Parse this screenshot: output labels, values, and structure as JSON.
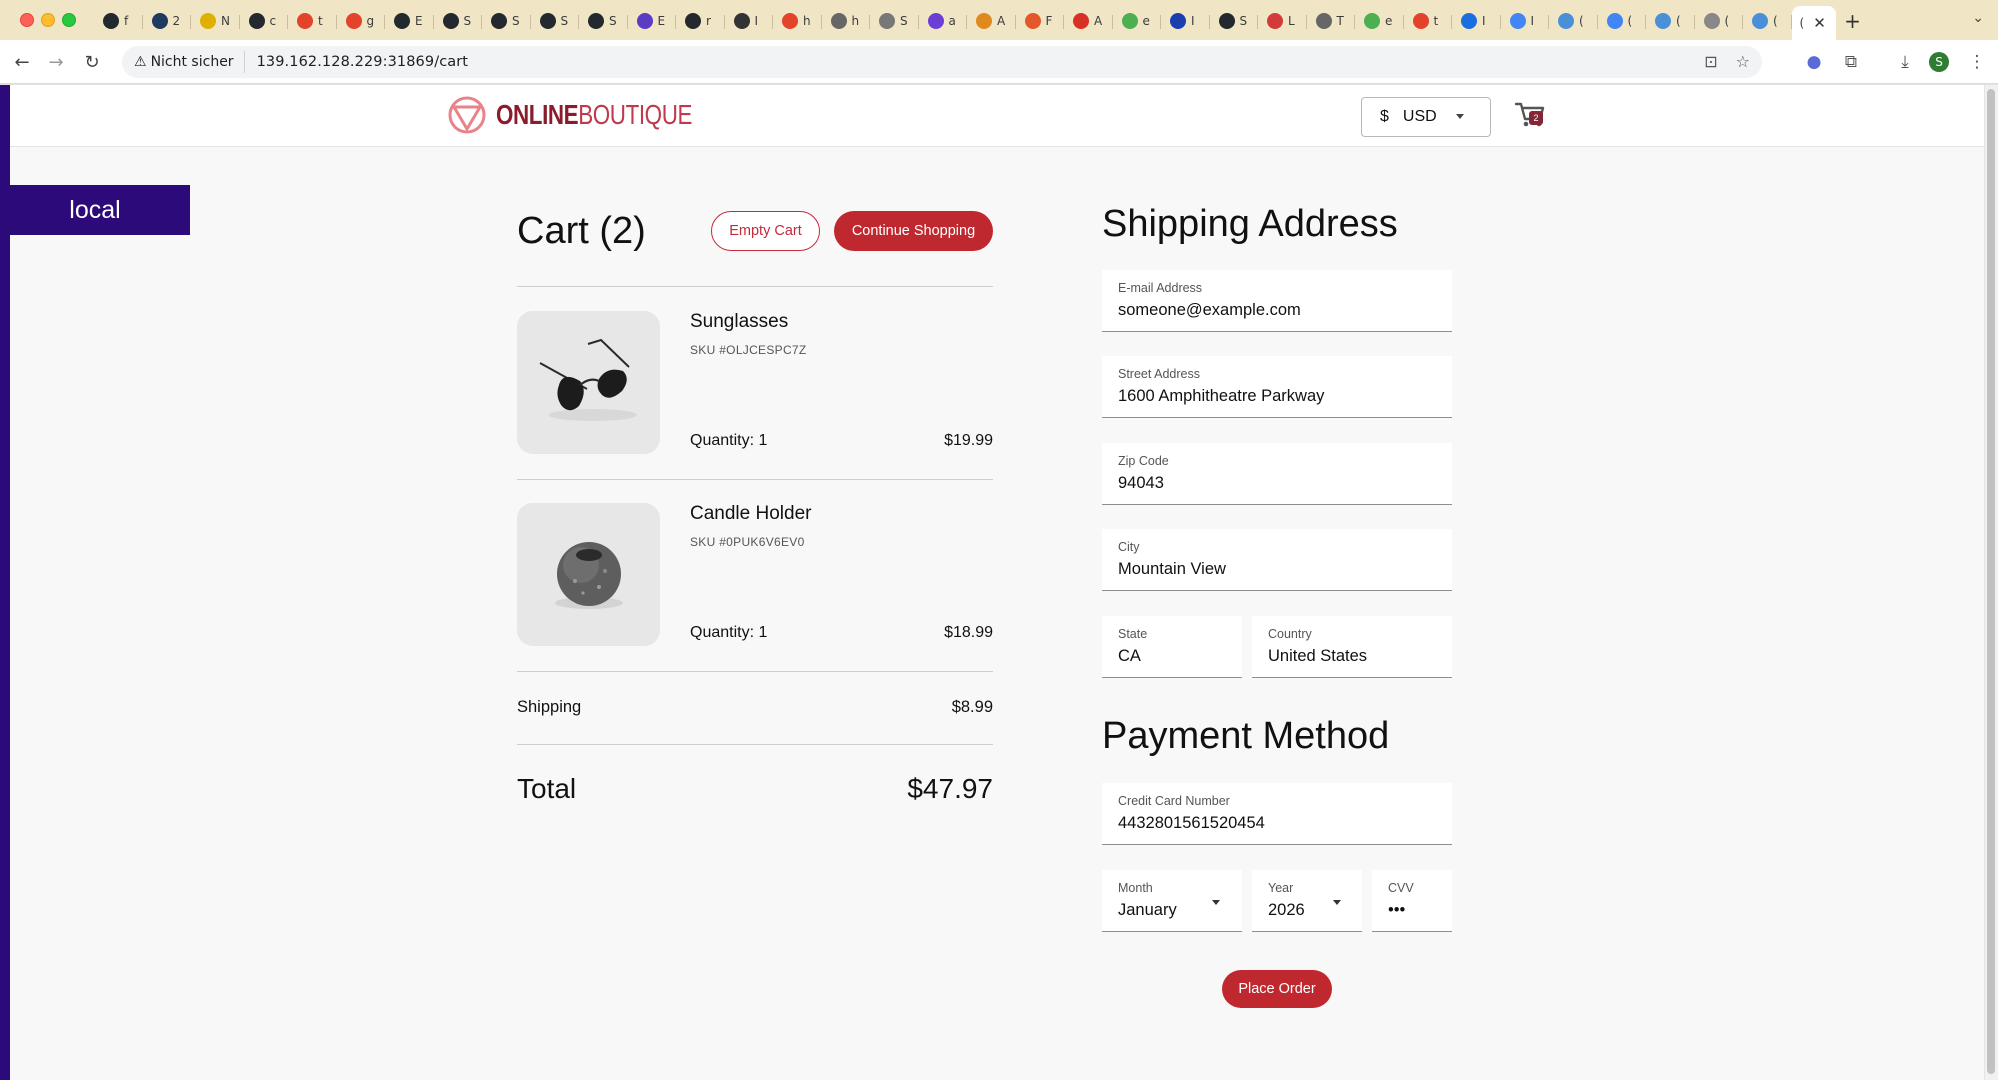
{
  "browser": {
    "tabs": [
      {
        "icon": "github-icon",
        "letter": "f",
        "color": "#24292f"
      },
      {
        "icon": "app-icon",
        "letter": "2",
        "color": "#1f3a5f"
      },
      {
        "icon": "yellow-app-icon",
        "letter": "N",
        "color": "#e0b000"
      },
      {
        "icon": "github-icon",
        "letter": "c",
        "color": "#24292f"
      },
      {
        "icon": "gitlab-icon",
        "letter": "t",
        "color": "#e24329"
      },
      {
        "icon": "gitlab-icon",
        "letter": "g",
        "color": "#e24329"
      },
      {
        "icon": "github-icon",
        "letter": "E",
        "color": "#24292f"
      },
      {
        "icon": "github-icon",
        "letter": "S",
        "color": "#24292f"
      },
      {
        "icon": "github-icon",
        "letter": "S",
        "color": "#24292f"
      },
      {
        "icon": "github-icon",
        "letter": "S",
        "color": "#24292f"
      },
      {
        "icon": "github-icon",
        "letter": "S",
        "color": "#24292f"
      },
      {
        "icon": "list-app-icon",
        "letter": "E",
        "color": "#5b3cc4"
      },
      {
        "icon": "github-icon",
        "letter": "r",
        "color": "#24292f"
      },
      {
        "icon": "grafana-icon",
        "letter": "I",
        "color": "#333333"
      },
      {
        "icon": "gitlab-icon",
        "letter": "h",
        "color": "#e24329"
      },
      {
        "icon": "argo-icon",
        "letter": "h",
        "color": "#666666"
      },
      {
        "icon": "avatar-icon",
        "letter": "S",
        "color": "#777777"
      },
      {
        "icon": "purple-app-icon",
        "letter": "a",
        "color": "#6c3ed6"
      },
      {
        "icon": "box-icon",
        "letter": "A",
        "color": "#e08a1e"
      },
      {
        "icon": "orange-app-icon",
        "letter": "F",
        "color": "#e3582b"
      },
      {
        "icon": "red-app-icon",
        "letter": "A",
        "color": "#d93025"
      },
      {
        "icon": "green-app-icon",
        "letter": "e",
        "color": "#4caf50"
      },
      {
        "icon": "m-icon",
        "letter": "I",
        "color": "#1a3db0"
      },
      {
        "icon": "github-icon",
        "letter": "S",
        "color": "#24292f"
      },
      {
        "icon": "scissors-icon",
        "letter": "L",
        "color": "#d33b3b"
      },
      {
        "icon": "gray-app-icon",
        "letter": "T",
        "color": "#666666"
      },
      {
        "icon": "green-app-icon",
        "letter": "e",
        "color": "#4caf50"
      },
      {
        "icon": "gitlab-icon",
        "letter": "t",
        "color": "#e24329"
      },
      {
        "icon": "zm-icon",
        "letter": "I",
        "color": "#1a6fe0"
      },
      {
        "icon": "google-icon",
        "letter": "I",
        "color": "#4285f4"
      },
      {
        "icon": "loading-icon",
        "letter": "(",
        "color": "#4a90d9"
      },
      {
        "icon": "google-icon",
        "letter": "(",
        "color": "#4285f4"
      },
      {
        "icon": "loading-icon",
        "letter": "(",
        "color": "#4a90d9"
      },
      {
        "icon": "globe-icon",
        "letter": "(",
        "color": "#888888"
      },
      {
        "icon": "loading-icon",
        "letter": "(",
        "color": "#4a90d9"
      }
    ],
    "active_tab": {
      "letter": "(",
      "color": "#4a90d9"
    },
    "security_label": "Nicht sicher",
    "url": "139.162.128.229:31869/cart",
    "profile_initial": "S"
  },
  "header": {
    "logo_bold": "ONLINE",
    "logo_light": "BOUTIQUE",
    "currency_symbol": "$",
    "currency_code": "USD",
    "cart_count": "2"
  },
  "env_banner": "local",
  "cart": {
    "title": "Cart (2)",
    "empty_label": "Empty Cart",
    "continue_label": "Continue Shopping",
    "items": [
      {
        "name": "Sunglasses",
        "sku": "SKU #OLJCESPC7Z",
        "quantity": "Quantity: 1",
        "price": "$19.99"
      },
      {
        "name": "Candle Holder",
        "sku": "SKU #0PUK6V6EV0",
        "quantity": "Quantity: 1",
        "price": "$18.99"
      }
    ],
    "shipping_label": "Shipping",
    "shipping_price": "$8.99",
    "total_label": "Total",
    "total_price": "$47.97"
  },
  "shipping": {
    "title": "Shipping Address",
    "email": {
      "label": "E-mail Address",
      "value": "someone@example.com"
    },
    "street": {
      "label": "Street Address",
      "value": "1600 Amphitheatre Parkway"
    },
    "zip": {
      "label": "Zip Code",
      "value": "94043"
    },
    "city": {
      "label": "City",
      "value": "Mountain View"
    },
    "state": {
      "label": "State",
      "value": "CA"
    },
    "country": {
      "label": "Country",
      "value": "United States"
    }
  },
  "payment": {
    "title": "Payment Method",
    "card": {
      "label": "Credit Card Number",
      "value": "4432801561520454"
    },
    "month": {
      "label": "Month",
      "value": "January"
    },
    "year": {
      "label": "Year",
      "value": "2026"
    },
    "cvv": {
      "label": "CVV",
      "value": "•••"
    },
    "order_label": "Place Order"
  },
  "colors": {
    "brand_red": "#c0282f",
    "env_purple": "#2d0a7a",
    "badge": "#852637"
  }
}
